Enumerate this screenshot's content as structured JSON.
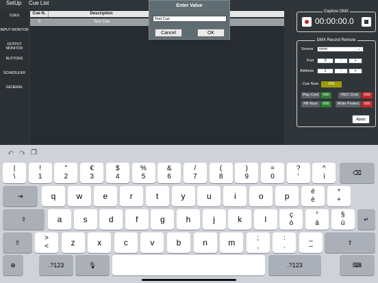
{
  "app": {
    "title": "SetUp",
    "section": "Cue List"
  },
  "sidebar": {
    "items": [
      "CUES",
      "INPUT MONITOR",
      "OUTPUT MONITOR",
      "BUTTONS",
      "SCHEDULER",
      "GENERAL"
    ]
  },
  "table": {
    "columns": [
      "Cue N.",
      "Description"
    ],
    "rows": [
      {
        "num": "0",
        "desc": "Test Cue"
      }
    ]
  },
  "dialog": {
    "title": "Enter Value",
    "value": "Test Cue",
    "cancel": "Cancel",
    "ok": "OK"
  },
  "capture": {
    "title": "Capture DMX",
    "time": "00:00:00.0"
  },
  "remote": {
    "title": "DMX Record Remote",
    "source_label": "Source",
    "source_value": "none",
    "port_label": "Port",
    "port_value": "0",
    "address_label": "Address",
    "address_value": "1",
    "minus": "-",
    "plus": "+",
    "cue_num_label": "Cue Num",
    "cue_num_value": "000",
    "play_cmd": "Play Cmd",
    "play_val": "000",
    "rec_cmd": "REC Cmd",
    "rec_val": "000",
    "pb_num": "PB Num",
    "pb_val": "000",
    "write_protect": "Write Protect",
    "wp_val": "000",
    "apply": "Apply"
  },
  "keyboard": {
    "row1": [
      [
        "|",
        "\\"
      ],
      [
        "!",
        "1"
      ],
      [
        "\"",
        "2"
      ],
      [
        "€",
        "3"
      ],
      [
        "$",
        "4"
      ],
      [
        "%",
        "5"
      ],
      [
        "&",
        "6"
      ],
      [
        "/",
        "7"
      ],
      [
        "(",
        "8"
      ],
      [
        ")",
        "9"
      ],
      [
        "=",
        "0"
      ],
      [
        "?",
        "'"
      ],
      [
        "^",
        "ì"
      ]
    ],
    "row2": [
      [
        "",
        "q"
      ],
      [
        "",
        "w"
      ],
      [
        "",
        "e"
      ],
      [
        "",
        "r"
      ],
      [
        "",
        "t"
      ],
      [
        "",
        "y"
      ],
      [
        "",
        "u"
      ],
      [
        "",
        "i"
      ],
      [
        "",
        "o"
      ],
      [
        "",
        "p"
      ],
      [
        "é",
        "è"
      ],
      [
        "*",
        "+"
      ]
    ],
    "row3": [
      [
        "",
        "a"
      ],
      [
        "",
        "s"
      ],
      [
        "",
        "d"
      ],
      [
        "",
        "f"
      ],
      [
        "",
        "g"
      ],
      [
        "",
        "h"
      ],
      [
        "",
        "j"
      ],
      [
        "",
        "k"
      ],
      [
        "",
        "l"
      ],
      [
        "ç",
        "ò"
      ],
      [
        "°",
        "à"
      ],
      [
        "§",
        "ù"
      ]
    ],
    "row4": [
      [
        ">",
        "<"
      ],
      [
        "",
        "z"
      ],
      [
        "",
        "x"
      ],
      [
        "",
        "c"
      ],
      [
        "",
        "v"
      ],
      [
        "",
        "b"
      ],
      [
        "",
        "n"
      ],
      [
        "",
        "m"
      ],
      [
        ";",
        ","
      ],
      [
        ":",
        "."
      ],
      [
        "_",
        "–"
      ]
    ],
    "numkey": ".?123"
  },
  "colors": {
    "accent_red": "#c62828",
    "green_badge": "#2e7d32",
    "yellow_badge": "#9e9a00"
  }
}
